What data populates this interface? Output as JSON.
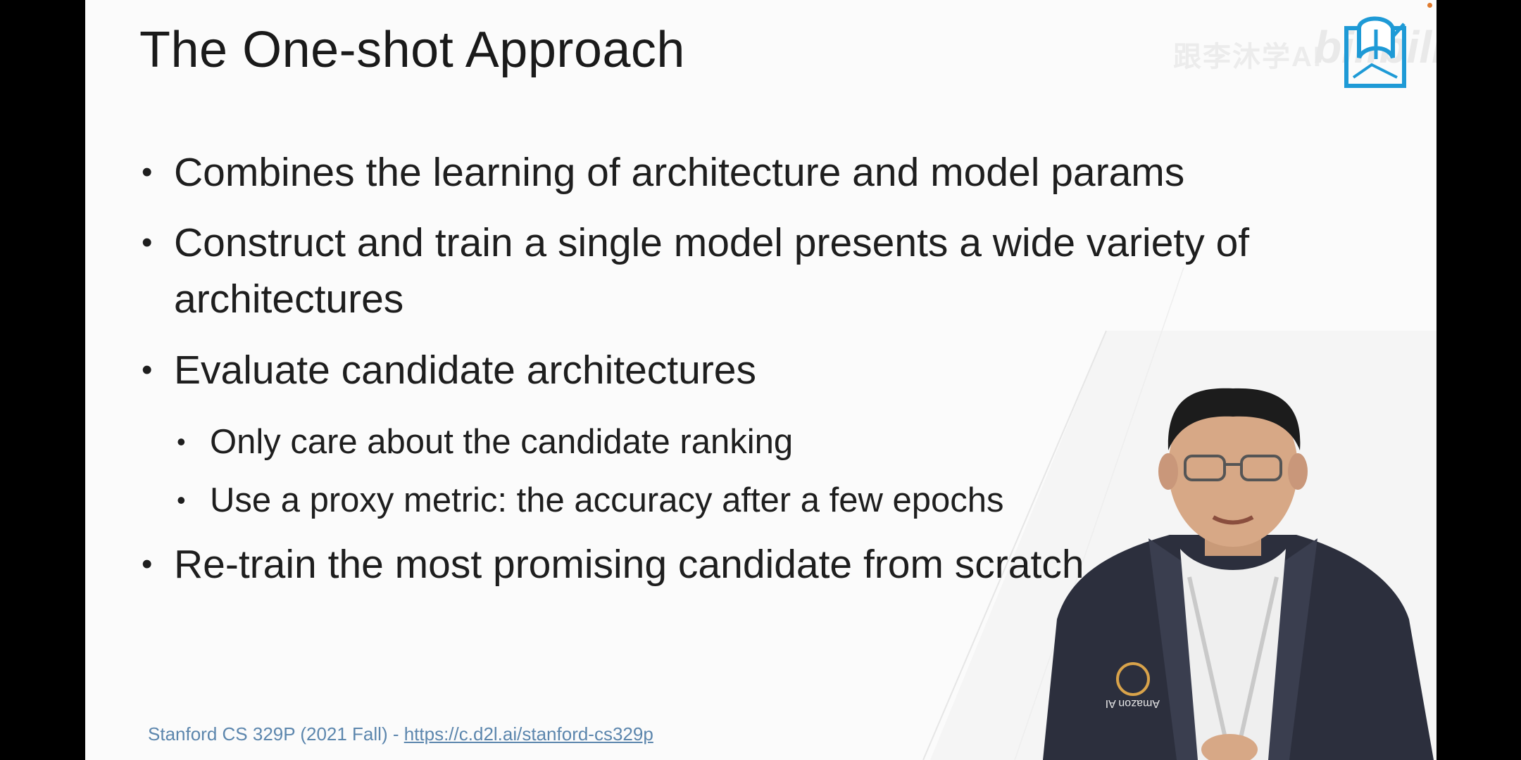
{
  "slide": {
    "title": "The One-shot Approach",
    "watermark_text": "跟李沐学AI",
    "watermark_brand": "bilibili",
    "bullets": [
      {
        "text": "Combines the learning of architecture and model params"
      },
      {
        "text_line1": "Construct and train a single model presents a wide variety of",
        "text_line2": "architectures"
      },
      {
        "text": "Evaluate candidate architectures"
      },
      {
        "text": "Re-train the most promising candidate from scratch"
      }
    ],
    "sub_bullets": [
      {
        "text": "Only care about the candidate ranking"
      },
      {
        "text": "Use a proxy metric: the accuracy after a few epochs"
      }
    ],
    "bullet_symbol": "•",
    "footer": {
      "prefix": "Stanford CS 329P (2021 Fall) - ",
      "link_text": "https://c.d2l.ai/stanford-cs329p"
    },
    "presenter_shirt_text": "Amazon AI"
  },
  "colors": {
    "slide_background": "#fbfbfb",
    "frame_background": "#000000",
    "text": "#1e1e1e",
    "footer_link": "#5c86ad",
    "logo_blue": "#1e9ad6",
    "corner_dot": "#e07b2e"
  },
  "icons": {
    "logo": "d2l-book-logo-icon"
  }
}
